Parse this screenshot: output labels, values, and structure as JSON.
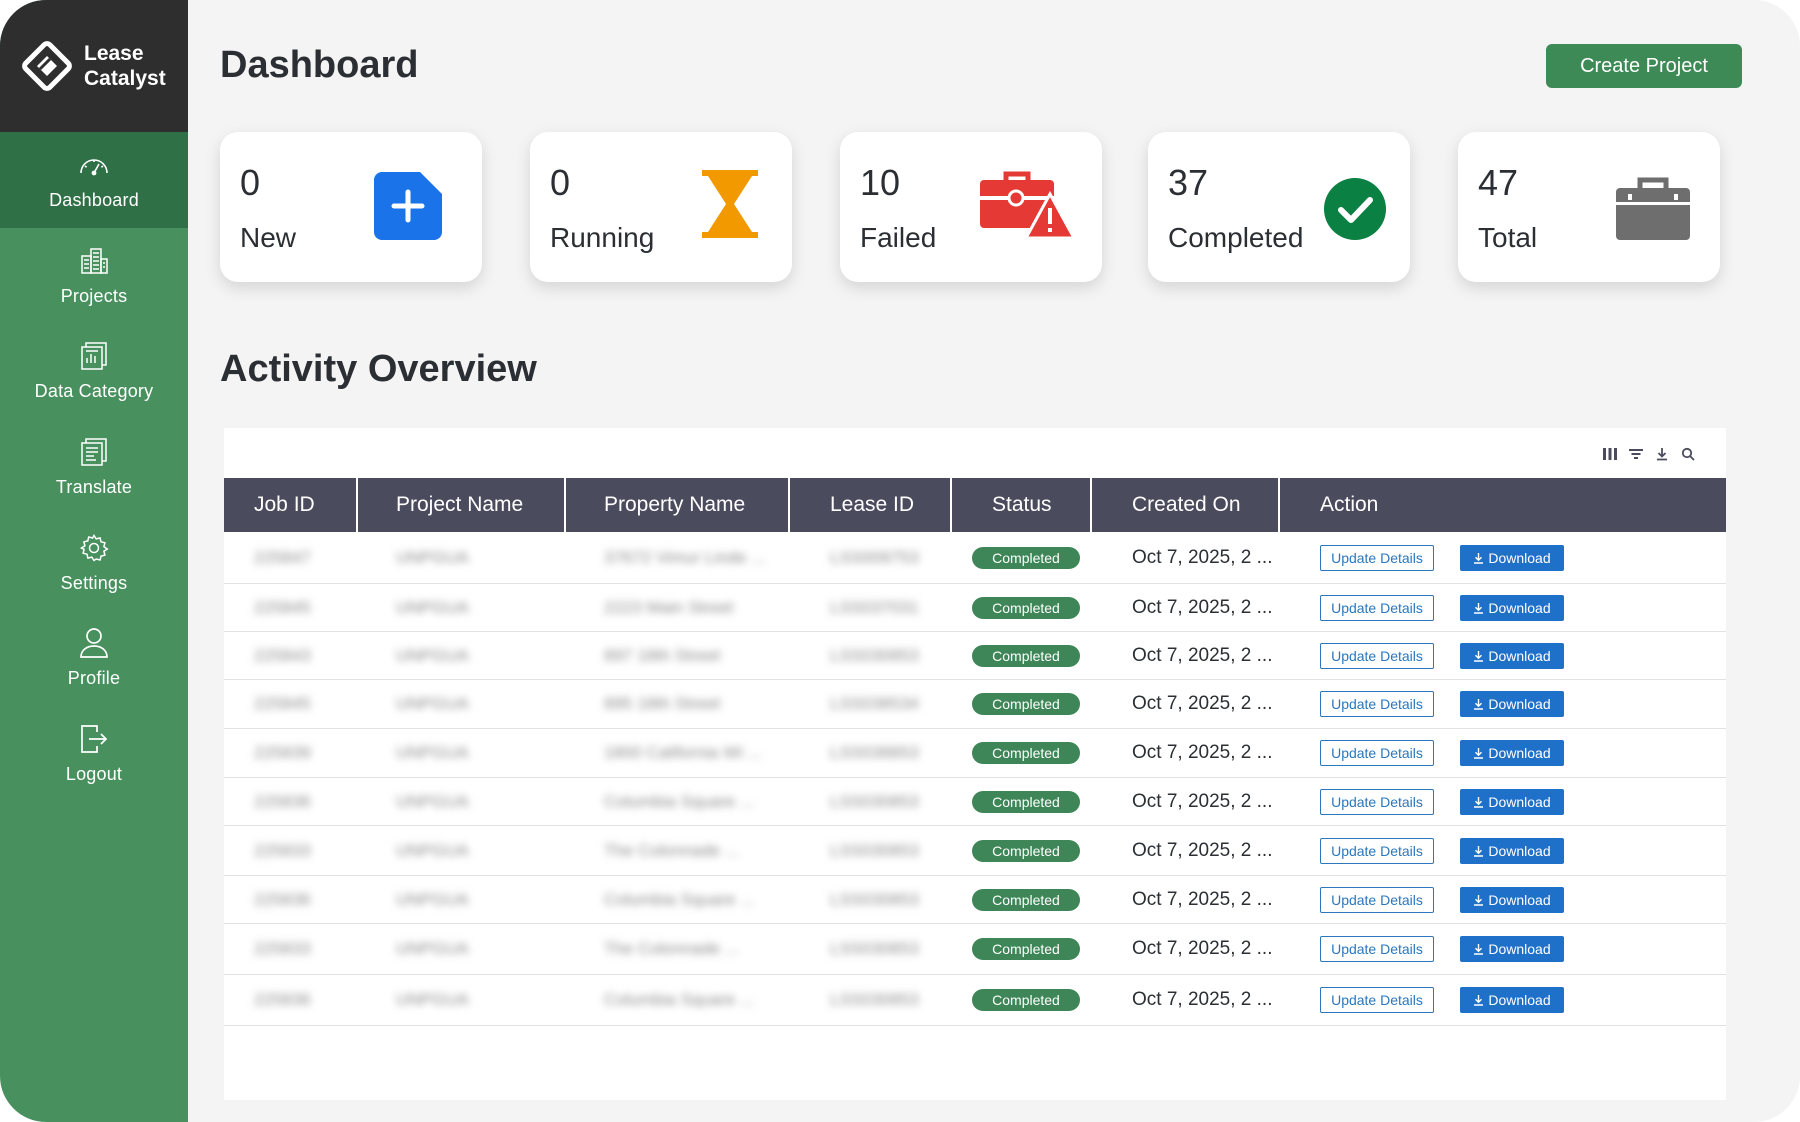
{
  "app": {
    "logo_line1": "Lease",
    "logo_line2": "Catalyst"
  },
  "sidebar": {
    "items": [
      {
        "label": "Dashboard",
        "icon": "gauge-icon",
        "active": true
      },
      {
        "label": "Projects",
        "icon": "buildings-icon"
      },
      {
        "label": "Data Category",
        "icon": "document-chart-icon"
      },
      {
        "label": "Translate",
        "icon": "document-translate-icon"
      },
      {
        "label": "Settings",
        "icon": "gear-icon"
      },
      {
        "label": "Profile",
        "icon": "user-icon"
      },
      {
        "label": "Logout",
        "icon": "logout-icon"
      }
    ]
  },
  "header": {
    "title": "Dashboard",
    "create_label": "Create Project"
  },
  "stats": [
    {
      "value": "0",
      "label": "New",
      "icon": "new-file-plus-icon",
      "color": "#1a73e8"
    },
    {
      "value": "0",
      "label": "Running",
      "icon": "hourglass-icon",
      "color": "#f29900"
    },
    {
      "value": "10",
      "label": "Failed",
      "icon": "briefcase-warning-icon",
      "color": "#e53935"
    },
    {
      "value": "37",
      "label": "Completed",
      "icon": "check-circle-icon",
      "color": "#0b8043"
    },
    {
      "value": "47",
      "label": "Total",
      "icon": "briefcase-icon",
      "color": "#6e6e6e"
    }
  ],
  "activity": {
    "title": "Activity Overview",
    "toolbar_icons": [
      "columns-icon",
      "filter-icon",
      "download-icon",
      "search-icon"
    ],
    "columns": [
      "Job ID",
      "Project Name",
      "Property Name",
      "Lease ID",
      "Status",
      "Created On",
      "Action"
    ],
    "update_label": "Update Details",
    "download_label": "Download",
    "rows": [
      {
        "job_id": "225847",
        "project": "UNPGUA",
        "property": "37672 Vimur Linde ...",
        "lease": "LSS009753",
        "status": "Completed",
        "created": "Oct 7, 2025, 2 ..."
      },
      {
        "job_id": "225845",
        "project": "UNPGUA",
        "property": "2223 Main Street",
        "lease": "LSS037031",
        "status": "Completed",
        "created": "Oct 7, 2025, 2 ..."
      },
      {
        "job_id": "225843",
        "project": "UNPGUA",
        "property": "897 18th Street",
        "lease": "LSS030853",
        "status": "Completed",
        "created": "Oct 7, 2025, 2 ..."
      },
      {
        "job_id": "225845",
        "project": "UNPGUA",
        "property": "895 18th Street",
        "lease": "LSS038534",
        "status": "Completed",
        "created": "Oct 7, 2025, 2 ..."
      },
      {
        "job_id": "225839",
        "project": "UNPGUA",
        "property": "1800 California Wi ...",
        "lease": "LSS038853",
        "status": "Completed",
        "created": "Oct 7, 2025, 2 ..."
      },
      {
        "job_id": "225836",
        "project": "UNPGUA",
        "property": "Columbia Square ...",
        "lease": "LSS030853",
        "status": "Completed",
        "created": "Oct 7, 2025, 2 ..."
      },
      {
        "job_id": "225833",
        "project": "UNPGUA",
        "property": "The Colonnade ...",
        "lease": "LSS030853",
        "status": "Completed",
        "created": "Oct 7, 2025, 2 ..."
      },
      {
        "job_id": "225836",
        "project": "UNPGUA",
        "property": "Columbia Square ...",
        "lease": "LSS030853",
        "status": "Completed",
        "created": "Oct 7, 2025, 2 ..."
      },
      {
        "job_id": "225833",
        "project": "UNPGUA",
        "property": "The Colonnade ...",
        "lease": "LSS030853",
        "status": "Completed",
        "created": "Oct 7, 2025, 2 ..."
      },
      {
        "job_id": "225836",
        "project": "UNPGUA",
        "property": "Columbia Square ...",
        "lease": "LSS030853",
        "status": "Completed",
        "created": "Oct 7, 2025, 2 ..."
      }
    ]
  },
  "colors": {
    "sidebar": "#48915f",
    "sidebar_active": "#2f7047",
    "logo_bg": "#2e2e2e",
    "table_header": "#4b4b5e",
    "badge": "#3e8657",
    "link_blue": "#2a77bd"
  }
}
